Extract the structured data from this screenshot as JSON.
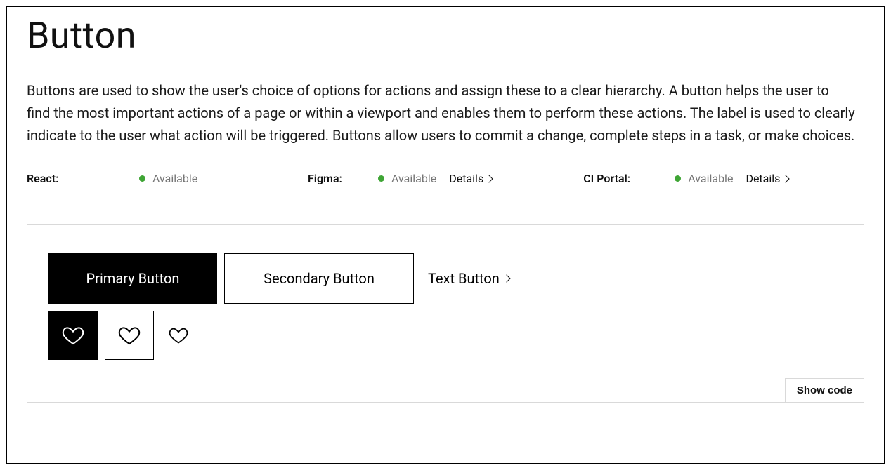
{
  "title": "Button",
  "description": "Buttons are used to show the user's choice of options for actions and assign these to a clear hierarchy. A button helps the user to find the most important actions of a page or within a viewport and enables them to perform these actions. The label is used to clearly indicate to the user what action will be triggered. Buttons allow users to commit a change, complete steps in a task, or make choices.",
  "availability": {
    "react": {
      "label": "React:",
      "status": "Available"
    },
    "figma": {
      "label": "Figma:",
      "status": "Available",
      "details": "Details"
    },
    "ci_portal": {
      "label": "CI Portal:",
      "status": "Available",
      "details": "Details"
    }
  },
  "preview": {
    "primary_label": "Primary Button",
    "secondary_label": "Secondary Button",
    "text_label": "Text Button",
    "show_code_label": "Show code"
  }
}
